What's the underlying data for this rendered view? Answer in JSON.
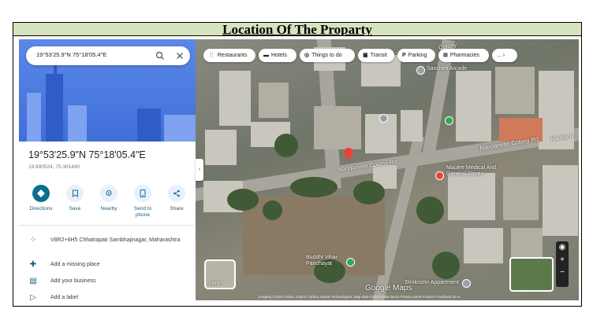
{
  "title": "Location Of The Proparty",
  "search": {
    "value": "19°53'25.9\"N 75°18'05.4\"E"
  },
  "place": {
    "title": "19°53'25.9\"N 75°18'05.4\"E",
    "decimal": "19.890524, 75.301490"
  },
  "actions": [
    {
      "label": "Directions"
    },
    {
      "label": "Save"
    },
    {
      "label": "Nearby"
    },
    {
      "label": "Send to phone"
    },
    {
      "label": "Share"
    }
  ],
  "details": [
    {
      "text": "V8R2+6H5 Chhatrapati Sambhajinagar, Maharashtra",
      "icon": "plus-code-icon"
    },
    {
      "text": "Add a missing place",
      "icon": "add-place-icon"
    },
    {
      "text": "Add your business",
      "icon": "business-icon"
    },
    {
      "text": "Add a label",
      "icon": "label-icon"
    }
  ],
  "chips": [
    "Restaurants",
    "Hotels",
    "Things to do",
    "Transit",
    "Parking",
    "Pharmacies",
    "..."
  ],
  "map": {
    "roads": [
      "Nandanvan Colony Rd",
      "Nandanvan Colony Rd",
      "Nandanv",
      "Colony"
    ],
    "pois": [
      "Sancheti Arcade",
      "Maulee Medical And General Stores",
      "Buddhi Vihar Panchayat",
      "Shrikrishn Appartment"
    ],
    "layers_label": "Layers",
    "google": "Google Maps",
    "attribution": "Imagery ©2023 Airbus, CNES / Airbus, Maxar Technologies, Map data ©2023   India   Terms   Privacy   Send Product Feedback   20 m"
  },
  "colors": {
    "title_bg": "#d6e3bc",
    "accent": "#0b6e8c",
    "pin": "#ea4335"
  }
}
